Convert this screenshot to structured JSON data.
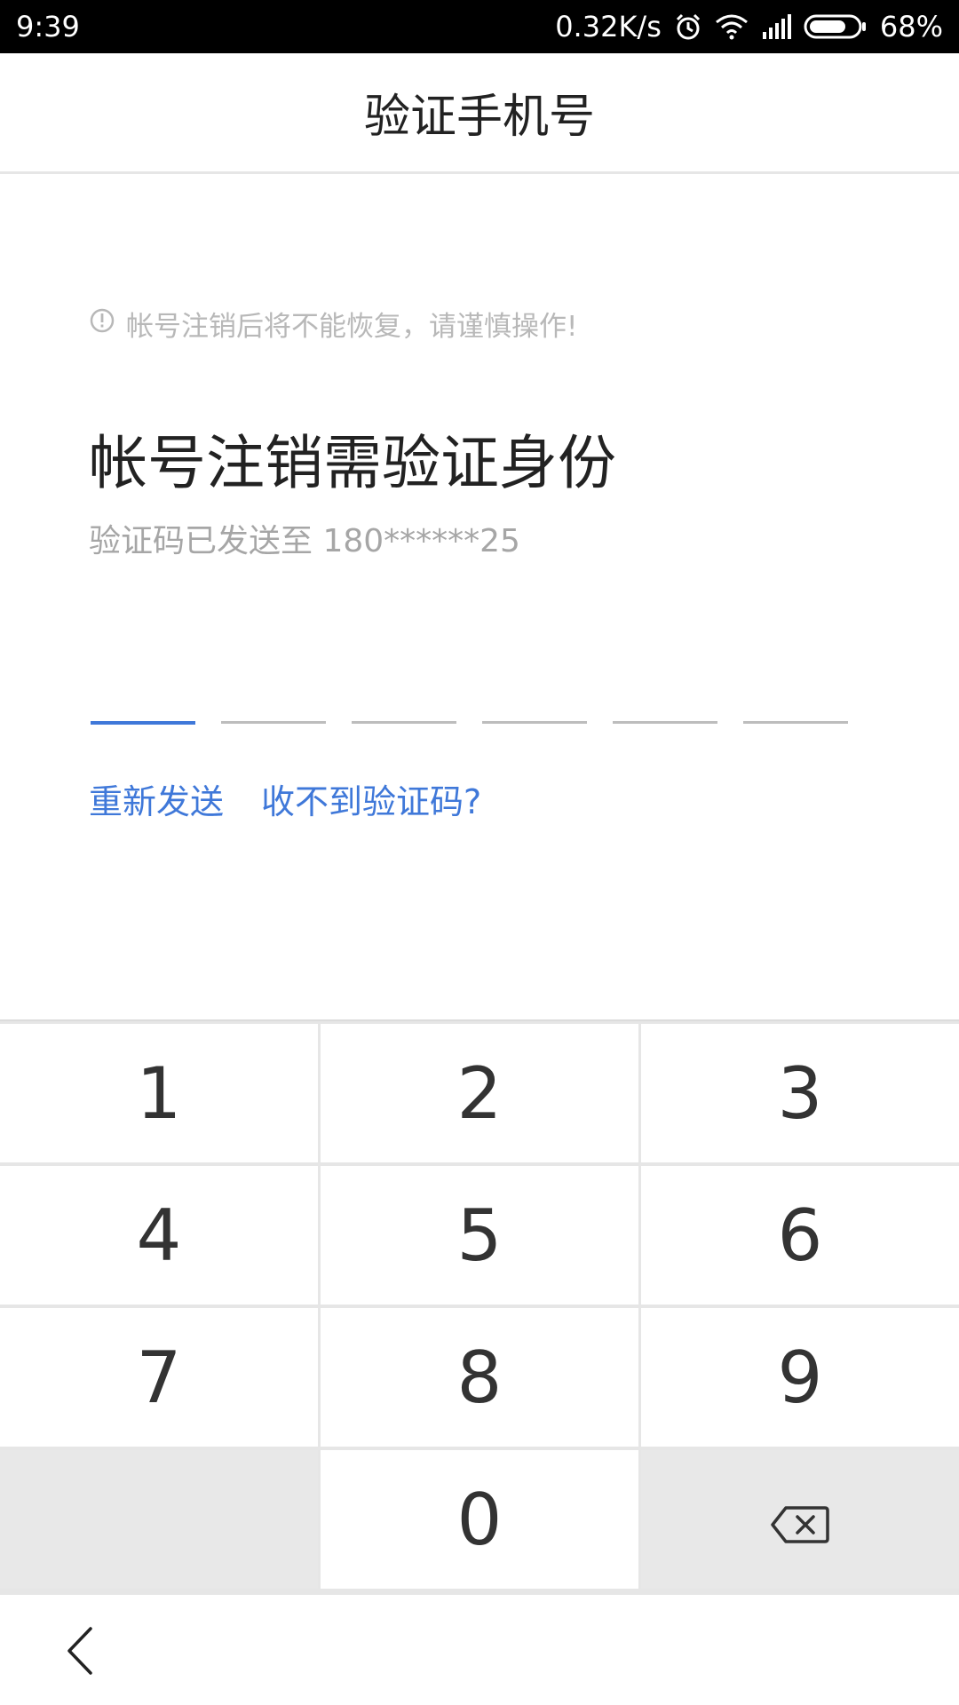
{
  "status_bar": {
    "time": "9:39",
    "net_speed": "0.32K/s",
    "battery_percent": "68%",
    "icons": [
      "alarm-icon",
      "wifi-icon",
      "signal-icon",
      "battery-icon"
    ]
  },
  "header": {
    "title": "验证手机号"
  },
  "warning": {
    "icon": "info-circle-icon",
    "text": "帐号注销后将不能恢复，请谨慎操作!"
  },
  "main": {
    "heading": "帐号注销需验证身份",
    "subtext": "验证码已发送至 180******25",
    "code_length": 6,
    "active_slot": 1
  },
  "links": {
    "resend": "重新发送",
    "no_code": "收不到验证码?"
  },
  "keypad": {
    "keys": [
      "1",
      "2",
      "3",
      "4",
      "5",
      "6",
      "7",
      "8",
      "9",
      "",
      "0",
      "backspace-icon"
    ]
  },
  "bottom_nav": {
    "back_icon": "chevron-left-icon"
  },
  "colors": {
    "accent": "#3f78d9",
    "text_primary": "#222222",
    "text_muted": "#a6a6a6",
    "keypad_bg": "#e6e6e6"
  }
}
